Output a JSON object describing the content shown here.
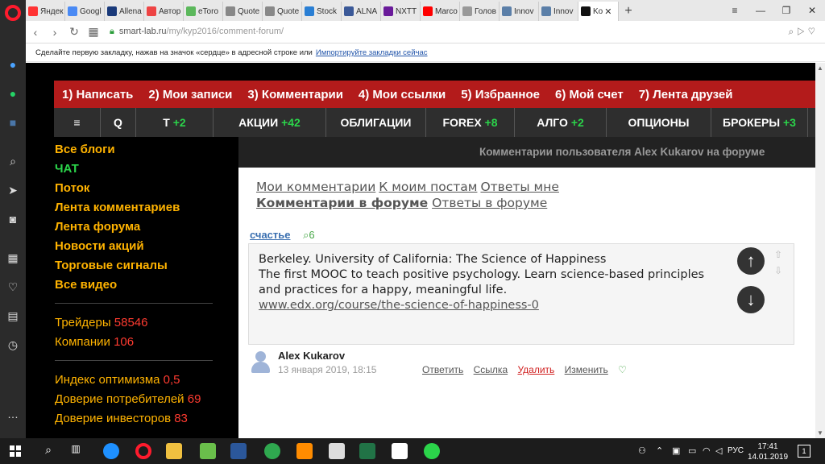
{
  "browser": {
    "tabs": [
      {
        "label": "Яндек",
        "color": "#ff3333"
      },
      {
        "label": "Googl",
        "color": "#4a8af4"
      },
      {
        "label": "Allena",
        "color": "#1a3a7a"
      },
      {
        "label": "Автор",
        "color": "#e44"
      },
      {
        "label": "eToro",
        "color": "#5cb85c"
      },
      {
        "label": "Quote",
        "color": "#888"
      },
      {
        "label": "Quote",
        "color": "#888"
      },
      {
        "label": "Stock",
        "color": "#2a7fd4"
      },
      {
        "label": "ALNA",
        "color": "#3b5998"
      },
      {
        "label": "NXTT",
        "color": "#6a1b9a"
      },
      {
        "label": "Marco",
        "color": "#ff0000"
      },
      {
        "label": "Голов",
        "color": "#999"
      },
      {
        "label": "Innov",
        "color": "#5b7fa8"
      },
      {
        "label": "Innov",
        "color": "#5b7fa8"
      },
      {
        "label": "Ko",
        "color": "#111"
      }
    ],
    "active_tab_index": 14,
    "new_tab": "+",
    "url_host": "smart-lab.ru",
    "url_path": "/my/kyp2016/comment-forum/",
    "bookmarks_text": "Сделайте первую закладку, нажав на значок «сердце» в адресной строке или",
    "bookmarks_link": "Импортируйте закладки сейчас"
  },
  "site": {
    "top_menu": [
      "1) Написать",
      "2) Мои записи",
      "3) Комментарии",
      "4) Мои ссылки",
      "5) Избранное",
      "6) Мой счет",
      "7) Лента друзей"
    ],
    "main_menu": [
      {
        "label": "Q",
        "badge": ""
      },
      {
        "label": "Т",
        "badge": "+2"
      },
      {
        "label": "АКЦИИ",
        "badge": "+42"
      },
      {
        "label": "ОБЛИГАЦИИ",
        "badge": ""
      },
      {
        "label": "FOREX",
        "badge": "+8"
      },
      {
        "label": "АЛГО",
        "badge": "+2"
      },
      {
        "label": "ОПЦИОНЫ",
        "badge": ""
      },
      {
        "label": "БРОКЕРЫ",
        "badge": "+3"
      }
    ],
    "left_nav": [
      "Все блоги",
      "ЧАТ",
      "Поток",
      "Лента комментариев",
      "Лента форума",
      "Новости акций",
      "Торговые сигналы",
      "Все видео"
    ],
    "stats1": [
      {
        "label": "Трейдеры",
        "value": "58546"
      },
      {
        "label": "Компании",
        "value": "106"
      }
    ],
    "stats2": [
      {
        "label": "Индекс оптимизма",
        "value": "0,5"
      },
      {
        "label": "Доверие потребителей",
        "value": "69"
      },
      {
        "label": "Доверие инвесторов",
        "value": "83"
      }
    ],
    "content_header": "Комментарии пользователя Alex Kukarov на форуме",
    "sublinks": {
      "my_comments": "Мои комментарии",
      "to_my_posts": "К моим постам",
      "replies_to_me": "Ответы мне",
      "forum_comments": "Комментарии в форуме",
      "forum_replies": "Ответы в форуме"
    },
    "comment": {
      "tag": "счастье",
      "count": "6",
      "line1": "Berkeley. University of California: The Science of Happiness",
      "line2": "The first MOOC to teach positive psychology. Learn science-based principles",
      "line3": "and practices for a happy, meaningful life.",
      "link": "www.edx.org/course/the-science-of-happiness-0",
      "author": "Alex Kukarov",
      "date": "13 января 2019, 18:15",
      "actions": {
        "reply": "Ответить",
        "link": "Ссылка",
        "delete": "Удалить",
        "edit": "Изменить"
      }
    }
  },
  "taskbar": {
    "lang": "РУС",
    "time": "17:41",
    "date": "14.01.2019",
    "notif": "1"
  }
}
